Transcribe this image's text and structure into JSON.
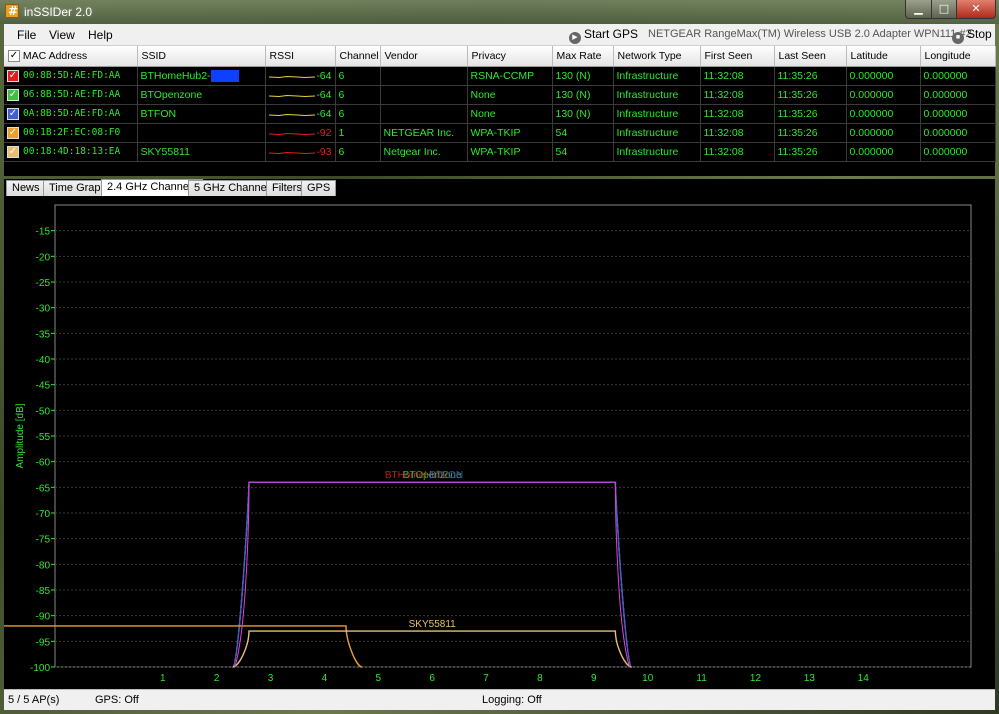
{
  "window": {
    "title": "inSSIDer 2.0"
  },
  "titlebar_buttons": {
    "minimize": "▁",
    "maximize": "□",
    "close": "✕"
  },
  "menu": {
    "items": [
      "File",
      "View",
      "Help"
    ]
  },
  "toolbar": {
    "start_gps": "Start GPS",
    "adapter": "NETGEAR RangeMax(TM) Wireless USB 2.0 Adapter WPN111 #2",
    "stop": "Stop"
  },
  "table": {
    "header_checkbox": "✓",
    "columns": [
      "MAC Address",
      "SSID",
      "RSSI",
      "Channel",
      "Vendor",
      "Privacy",
      "Max Rate",
      "Network Type",
      "First Seen",
      "Last Seen",
      "Latitude",
      "Longitude"
    ],
    "rows": [
      {
        "color": "#e02020",
        "check": "✓",
        "mac": "00:8B:5D:AE:FD:AA",
        "ssid": "BTHomeHub2-",
        "ssid_masked": "XXXX",
        "rssi": "-64",
        "rssi_color": "#2de82d",
        "spark_color": "#e8d040",
        "channel": "6",
        "vendor": "",
        "privacy": "RSNA-CCMP",
        "max_rate": "130 (N)",
        "network_type": "Infrastructure",
        "first_seen": "11:32:08",
        "last_seen": "11:35:26",
        "latitude": "0.000000",
        "longitude": "0.000000"
      },
      {
        "color": "#40c040",
        "check": "✓",
        "mac": "06:8B:5D:AE:FD:AA",
        "ssid": "BTOpenzone",
        "ssid_masked": "",
        "rssi": "-64",
        "rssi_color": "#2de82d",
        "spark_color": "#e8d040",
        "channel": "6",
        "vendor": "",
        "privacy": "None",
        "max_rate": "130 (N)",
        "network_type": "Infrastructure",
        "first_seen": "11:32:08",
        "last_seen": "11:35:26",
        "latitude": "0.000000",
        "longitude": "0.000000"
      },
      {
        "color": "#4060d0",
        "check": "✓",
        "mac": "0A:8B:5D:AE:FD:AA",
        "ssid": "BTFON",
        "ssid_masked": "",
        "rssi": "-64",
        "rssi_color": "#2de82d",
        "spark_color": "#e8d040",
        "channel": "6",
        "vendor": "",
        "privacy": "None",
        "max_rate": "130 (N)",
        "network_type": "Infrastructure",
        "first_seen": "11:32:08",
        "last_seen": "11:35:26",
        "latitude": "0.000000",
        "longitude": "0.000000"
      },
      {
        "color": "#e8a030",
        "check": "✓",
        "mac": "00:1B:2F:EC:08:F0",
        "ssid": "",
        "ssid_masked": "",
        "rssi": "-92",
        "rssi_color": "#e02020",
        "spark_color": "#e02020",
        "channel": "1",
        "vendor": "NETGEAR Inc.",
        "privacy": "WPA-TKIP",
        "max_rate": "54",
        "network_type": "Infrastructure",
        "first_seen": "11:32:08",
        "last_seen": "11:35:26",
        "latitude": "0.000000",
        "longitude": "0.000000"
      },
      {
        "color": "#e8c070",
        "check": "✓",
        "mac": "00:18:4D:18:13:EA",
        "ssid": "SKY55811",
        "ssid_masked": "",
        "rssi": "-93",
        "rssi_color": "#e02020",
        "spark_color": "#e02020",
        "channel": "6",
        "vendor": "Netgear Inc.",
        "privacy": "WPA-TKIP",
        "max_rate": "54",
        "network_type": "Infrastructure",
        "first_seen": "11:32:08",
        "last_seen": "11:35:26",
        "latitude": "0.000000",
        "longitude": "0.000000"
      }
    ]
  },
  "tabs": [
    {
      "label": "News",
      "active": false
    },
    {
      "label": "Time Graph",
      "active": false
    },
    {
      "label": "2.4 GHz Channels",
      "active": true
    },
    {
      "label": "5 GHz Channels",
      "active": false
    },
    {
      "label": "Filters",
      "active": false
    },
    {
      "label": "GPS",
      "active": false
    }
  ],
  "chart_data": {
    "type": "area",
    "title": "",
    "xlabel": "",
    "ylabel": "Amplitude [dB]",
    "y_ticks": [
      -15,
      -20,
      -25,
      -30,
      -35,
      -40,
      -45,
      -50,
      -55,
      -60,
      -65,
      -70,
      -75,
      -80,
      -85,
      -90,
      -95,
      -100
    ],
    "ylim": [
      -100,
      -10
    ],
    "x_ticks": [
      1,
      2,
      3,
      4,
      5,
      6,
      7,
      8,
      9,
      10,
      11,
      12,
      13,
      14
    ],
    "xlim": [
      -1,
      16
    ],
    "grid": true,
    "series": [
      {
        "name": "BTHomeHub2-",
        "color": "#e02020",
        "channel": 6,
        "amplitude": -64,
        "label_shown": true
      },
      {
        "name": "BTOpenzone",
        "color": "#40c040",
        "channel": 6,
        "amplitude": -64,
        "label_shown": true
      },
      {
        "name": "BTFON",
        "color": "#4060d0",
        "channel": 6,
        "amplitude": -64,
        "label_shown": true
      },
      {
        "name": "",
        "color": "#e8a030",
        "channel": 1,
        "amplitude": -92,
        "label_shown": false
      },
      {
        "name": "SKY55811",
        "color": "#e8c070",
        "channel": 6,
        "amplitude": -93,
        "label_shown": true
      }
    ],
    "overlap_label_color": "#e040e0",
    "tick_color": "#2de82d",
    "grid_color": "#3a3a3a"
  },
  "status": {
    "ap_count": "5 / 5 AP(s)",
    "gps": "GPS: Off",
    "logging": "Logging: Off"
  }
}
